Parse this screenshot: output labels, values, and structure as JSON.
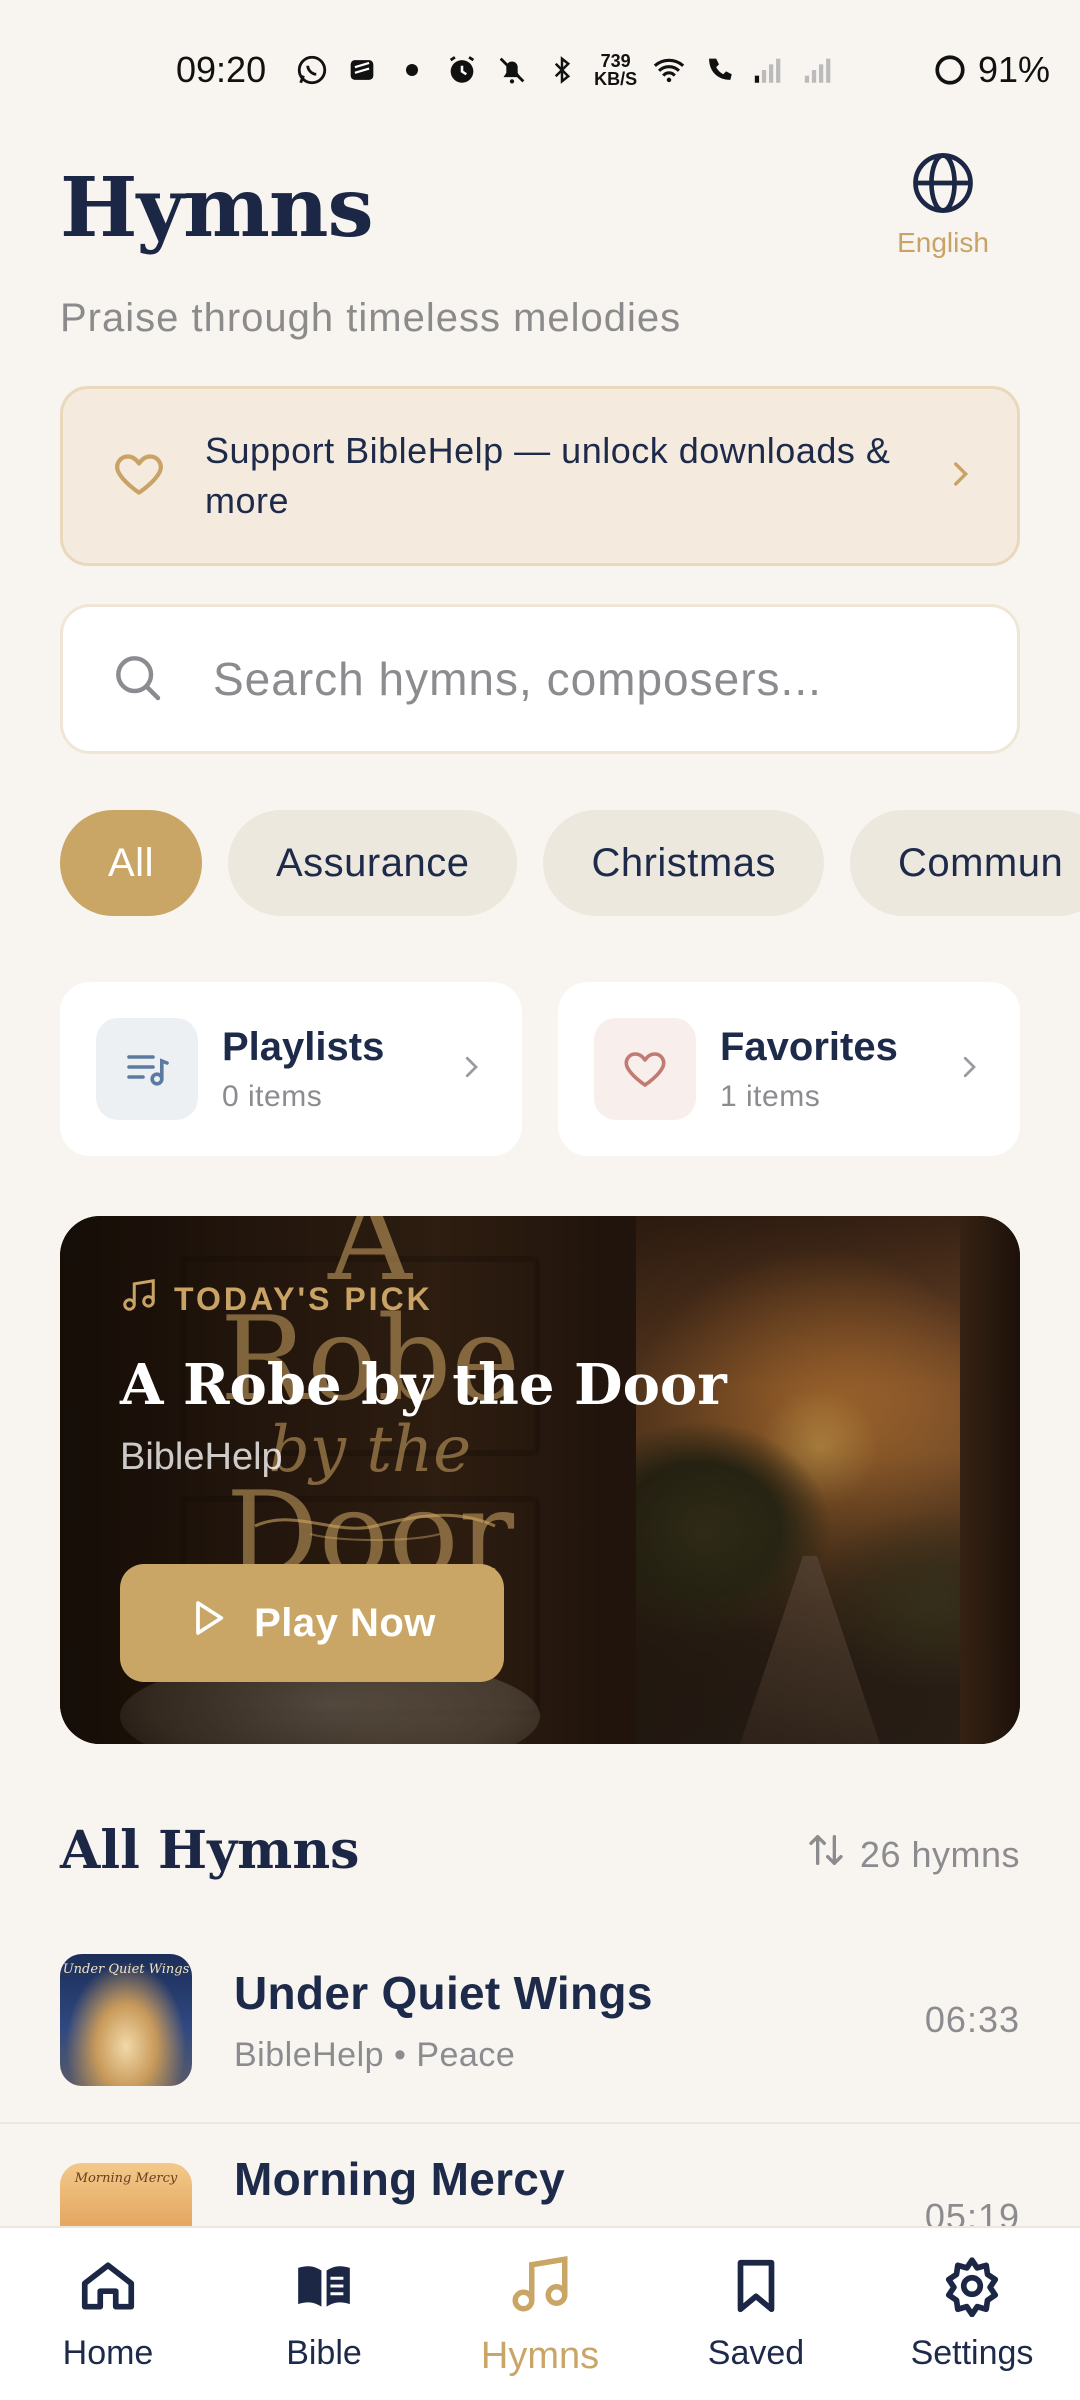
{
  "status_bar": {
    "time": "09:20",
    "net_speed_value": "739",
    "net_speed_unit": "KB/S",
    "battery": "91%"
  },
  "header": {
    "title": "Hymns",
    "subtitle": "Praise through timeless melodies",
    "language_label": "English",
    "language_icon": "globe-icon"
  },
  "support_banner": {
    "text": "Support BibleHelp — unlock downloads & more",
    "icon": "heart-icon"
  },
  "search": {
    "placeholder": "Search hymns, composers...",
    "value": ""
  },
  "categories": [
    {
      "label": "All",
      "active": true
    },
    {
      "label": "Assurance",
      "active": false
    },
    {
      "label": "Christmas",
      "active": false
    },
    {
      "label": "Commun",
      "active": false
    }
  ],
  "quick_cards": {
    "playlists": {
      "title": "Playlists",
      "count": "0 items"
    },
    "favorites": {
      "title": "Favorites",
      "count": "1 items"
    }
  },
  "featured": {
    "badge": "TODAY'S PICK",
    "title": "A Robe by the Door",
    "artist": "BibleHelp",
    "play_label": "Play Now",
    "artwork_text": {
      "line1": "A Robe",
      "line2": "by the",
      "line3": "Door"
    }
  },
  "all_hymns": {
    "title": "All Hymns",
    "count": "26 hymns",
    "items": [
      {
        "title": "Under Quiet Wings",
        "subtitle": "BibleHelp • Peace",
        "duration": "06:33",
        "thumb_caption": "Under Quiet Wings"
      },
      {
        "title": "Morning Mercy",
        "subtitle": "",
        "duration": "05:19",
        "thumb_caption": "Morning Mercy"
      }
    ]
  },
  "bottom_nav": [
    {
      "label": "Home",
      "icon": "home-icon",
      "active": false
    },
    {
      "label": "Bible",
      "icon": "book-icon",
      "active": false
    },
    {
      "label": "Hymns",
      "icon": "music-note-icon",
      "active": true
    },
    {
      "label": "Saved",
      "icon": "bookmark-icon",
      "active": false
    },
    {
      "label": "Settings",
      "icon": "gear-icon",
      "active": false
    }
  ],
  "colors": {
    "background": "#f8f5f0",
    "accent_gold": "#c9a665",
    "navy": "#1c2745",
    "muted": "#8c8b8f"
  }
}
